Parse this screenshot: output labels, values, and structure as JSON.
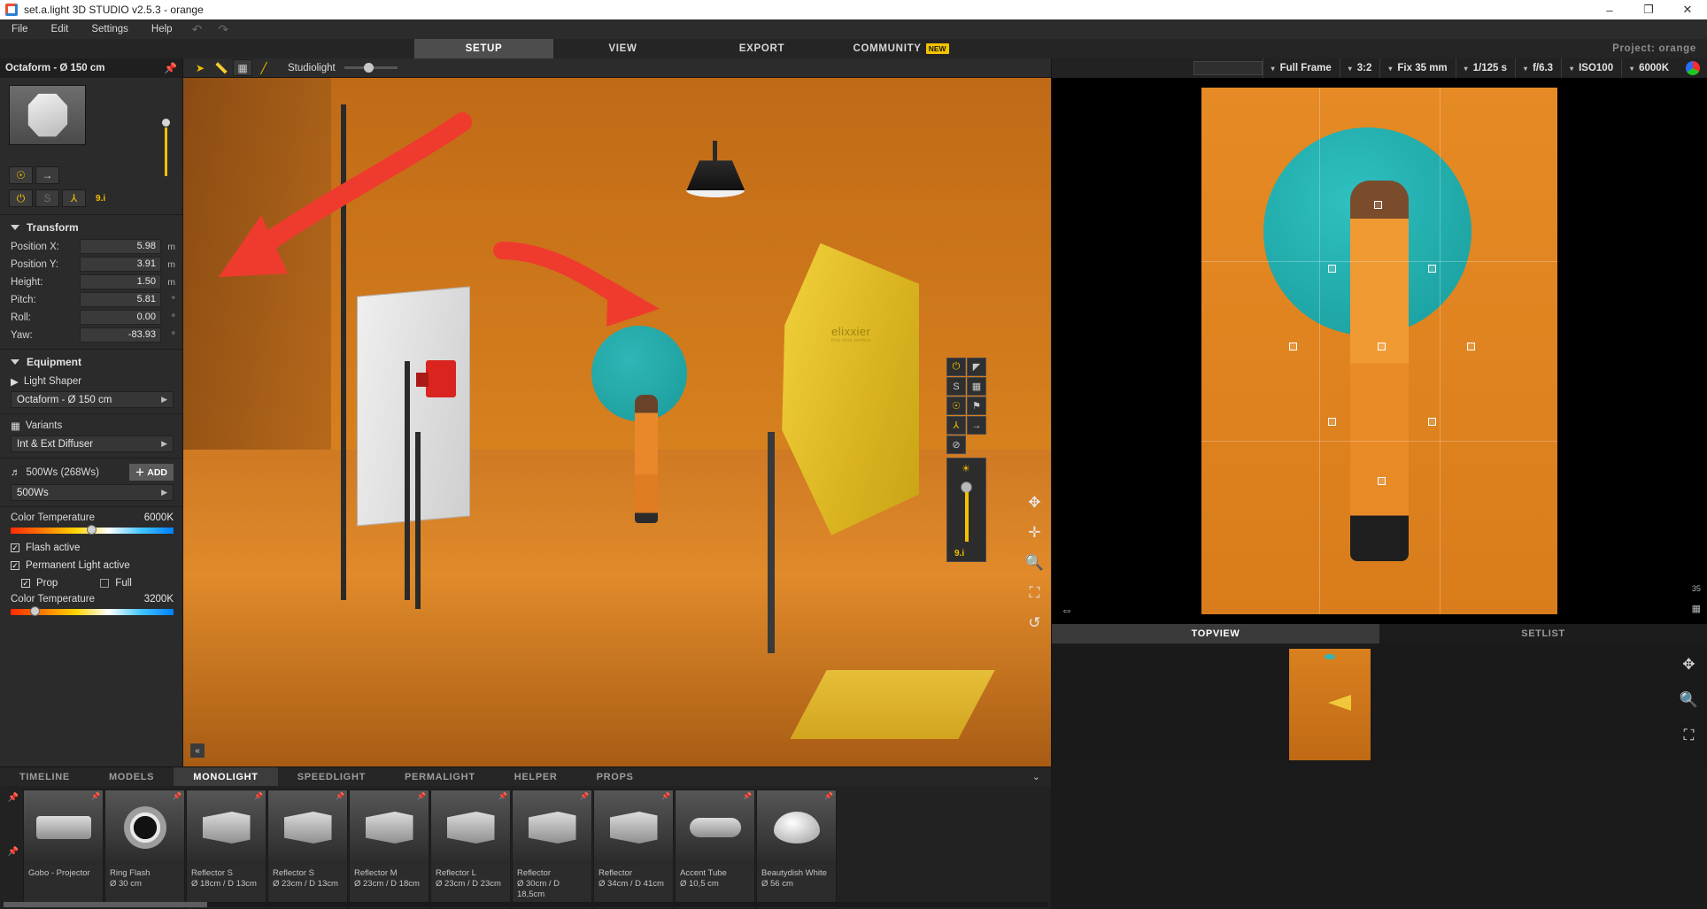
{
  "window": {
    "title": "set.a.light 3D STUDIO v2.5.3 - orange",
    "minimize": "–",
    "maximize": "❐",
    "close": "✕"
  },
  "menu": {
    "items": [
      "File",
      "Edit",
      "Settings",
      "Help"
    ],
    "undo_icon": "↶",
    "redo_icon": "↷"
  },
  "main_tabs": {
    "items": [
      {
        "label": "SETUP",
        "active": true,
        "badge": ""
      },
      {
        "label": "VIEW",
        "active": false,
        "badge": ""
      },
      {
        "label": "EXPORT",
        "active": false,
        "badge": ""
      },
      {
        "label": "COMMUNITY",
        "active": false,
        "badge": "NEW"
      }
    ],
    "project": "Project: orange"
  },
  "sidebar": {
    "header": "Octaform - Ø 150 cm",
    "pin_icon": "📌",
    "icon_row_1": [
      {
        "name": "target-icon",
        "glyph": "☉"
      },
      {
        "name": "person-arrow-icon",
        "glyph": "→"
      }
    ],
    "icon_row_2": [
      {
        "name": "power-icon",
        "glyph": "⏻",
        "state": "on"
      },
      {
        "name": "shadow-icon",
        "glyph": "S",
        "state": "off"
      },
      {
        "name": "tripod-icon",
        "glyph": "⅄",
        "state": "on"
      }
    ],
    "watt_label": "9.i",
    "transform": {
      "title": "Transform",
      "rows": [
        {
          "label": "Position X:",
          "value": "5.98",
          "unit": "m"
        },
        {
          "label": "Position Y:",
          "value": "3.91",
          "unit": "m"
        },
        {
          "label": "Height:",
          "value": "1.50",
          "unit": "m"
        },
        {
          "label": "Pitch:",
          "value": "5.81",
          "unit": "°"
        },
        {
          "label": "Roll:",
          "value": "0.00",
          "unit": "°"
        },
        {
          "label": "Yaw:",
          "value": "-83.93",
          "unit": "°"
        }
      ]
    },
    "equipment": {
      "title": "Equipment",
      "light_shaper_label": "Light Shaper",
      "light_shaper_value": "Octaform - Ø 150 cm",
      "variants_label": "Variants",
      "variants_value": "Int & Ext Diffuser",
      "power_label": "500Ws (268Ws)",
      "add_label": "ADD",
      "add_icon": "＋",
      "power_value": "500Ws",
      "color_temp_label": "Color Temperature",
      "color_temp_value": "6000K"
    },
    "checks": [
      {
        "label": "Flash active",
        "checked": true,
        "sub": false
      },
      {
        "label": "Permanent Light active",
        "checked": true,
        "sub": false
      }
    ],
    "prop_row": {
      "prop_label": "Prop",
      "prop_checked": true,
      "full_label": "Full",
      "full_checked": false
    },
    "perm_color_temp_label": "Color Temperature",
    "perm_color_temp_value": "3200K"
  },
  "viewport": {
    "toolbar": {
      "cursor_icon": "➤",
      "measure_icon": "📏",
      "grid_icon": "▦",
      "line_icon": "╱",
      "studiolight_label": "Studiolight"
    },
    "scene": {
      "softbox_brand": "elixxier",
      "softbox_tagline": "first shot perfect"
    },
    "hud": {
      "buttons": [
        {
          "name": "power-icon",
          "glyph": "⏻",
          "on": true
        },
        {
          "name": "light-cone-icon",
          "glyph": "◤",
          "on": false
        },
        {
          "name": "shadow-icon",
          "glyph": "S",
          "on": false
        },
        {
          "name": "grid-icon",
          "glyph": "▦",
          "on": false
        },
        {
          "name": "target-icon",
          "glyph": "☉",
          "on": true
        },
        {
          "name": "lamp-icon",
          "glyph": "⚑",
          "on": false
        },
        {
          "name": "tripod-icon",
          "glyph": "⅄",
          "on": true
        },
        {
          "name": "person-arrow-icon",
          "glyph": "→",
          "on": false
        },
        {
          "name": "no-render-icon",
          "glyph": "⊘",
          "on": false
        }
      ],
      "slider_icon": "☀",
      "slider_value": "9.i"
    },
    "side_icons": [
      {
        "name": "move-gizmo-icon",
        "glyph": "✥"
      },
      {
        "name": "pan-icon",
        "glyph": "✛"
      },
      {
        "name": "zoom-icon",
        "glyph": "🔍"
      },
      {
        "name": "fit-icon",
        "glyph": "⛶"
      },
      {
        "name": "reset-icon",
        "glyph": "↺"
      }
    ],
    "collapse_icon": "«"
  },
  "camera_bar": {
    "items": [
      {
        "value": "Full Frame",
        "arrow": "▾"
      },
      {
        "value": "3:2",
        "arrow": "▾"
      },
      {
        "value": "Fix 35 mm",
        "arrow": "▾"
      },
      {
        "value": "1/125 s",
        "arrow": "▾"
      },
      {
        "value": "f/6.3",
        "arrow": "▾"
      },
      {
        "value": "ISO100",
        "arrow": "▾"
      },
      {
        "value": "6000K",
        "arrow": "▾"
      }
    ],
    "color_icon": "rgb-wheel-icon"
  },
  "right_panel": {
    "tabs": [
      {
        "label": "TOPVIEW",
        "active": true
      },
      {
        "label": "SETLIST",
        "active": false
      }
    ],
    "side_icons": [
      "35",
      "▦",
      "☰",
      "◯",
      "◑"
    ],
    "bottom_left_icon": "⇔",
    "topview_icons": [
      "✥",
      "🔍",
      "⛶"
    ]
  },
  "library": {
    "tabs": [
      {
        "label": "TIMELINE",
        "active": false
      },
      {
        "label": "MODELS",
        "active": false
      },
      {
        "label": "MONOLIGHT",
        "active": true
      },
      {
        "label": "SPEEDLIGHT",
        "active": false
      },
      {
        "label": "PERMALIGHT",
        "active": false
      },
      {
        "label": "HELPER",
        "active": false
      },
      {
        "label": "PROPS",
        "active": false
      }
    ],
    "collapse_icon": "⌄",
    "items": [
      {
        "name": "Gobo - Projector",
        "spec": "",
        "shape": "gobo"
      },
      {
        "name": "Ring Flash",
        "spec": "Ø 30 cm",
        "shape": "ring"
      },
      {
        "name": "Reflector S",
        "spec": "Ø 18cm / D 13cm",
        "shape": "cone"
      },
      {
        "name": "Reflector S",
        "spec": "Ø 23cm / D 13cm",
        "shape": "cone"
      },
      {
        "name": "Reflector M",
        "spec": "Ø 23cm / D 18cm",
        "shape": "cone"
      },
      {
        "name": "Reflector L",
        "spec": "Ø 23cm / D 23cm",
        "shape": "cone"
      },
      {
        "name": "Reflector",
        "spec": "Ø 30cm / D 18,5cm",
        "shape": "cone"
      },
      {
        "name": "Reflector",
        "spec": "Ø 34cm / D 41cm",
        "shape": "cone"
      },
      {
        "name": "Accent Tube",
        "spec": "Ø 10,5 cm",
        "shape": "tube"
      },
      {
        "name": "Beautydish White",
        "spec": "Ø 56 cm",
        "shape": "dish"
      }
    ],
    "pin_icon": "📌"
  },
  "annotations": {
    "arrow_color": "#ef3b2d"
  }
}
